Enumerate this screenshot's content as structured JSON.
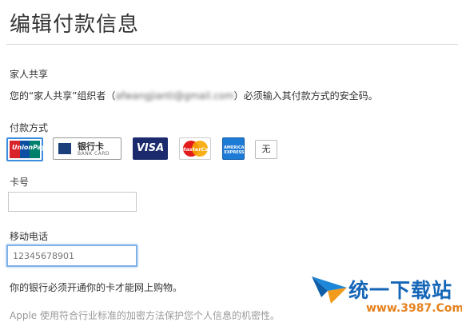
{
  "page": {
    "title": "编辑付款信息"
  },
  "family_sharing": {
    "heading": "家人共享",
    "message_prefix": "您的“家人共享”组织者（",
    "organizer_email": "afwangjianti@gmail.com",
    "message_suffix": "）必须输入其付款方式的安全码。"
  },
  "payment_method": {
    "heading": "付款方式",
    "options": [
      {
        "name": "UnionPay",
        "text": "UnionPay",
        "selected": true
      },
      {
        "name": "bank-card",
        "text": "银行卡",
        "subtext": "BANK CARD",
        "selected": false
      },
      {
        "name": "visa",
        "text": "VISA",
        "selected": false
      },
      {
        "name": "mastercard",
        "text": "MasterCard",
        "selected": false
      },
      {
        "name": "amex",
        "text": "AMERICAN EXPRESS",
        "selected": false
      },
      {
        "name": "none",
        "text": "无",
        "selected": false
      }
    ]
  },
  "card_number": {
    "label": "卡号",
    "value": "",
    "placeholder": ""
  },
  "mobile_phone": {
    "label": "移动电话",
    "value": "",
    "placeholder": "12345678901"
  },
  "notes": {
    "bank": "你的银行必须开通你的卡才能网上购物。",
    "security": "Apple 使用符合行业标准的加密方法保护您个人信息的机密性。"
  },
  "watermark": {
    "title": "统一下载站",
    "url": "www.3987.Com"
  },
  "colors": {
    "focus_border": "#7fb1e8",
    "visa_blue": "#1a2a6c",
    "watermark_blue": "#1666b7",
    "watermark_orange": "#e5821e"
  }
}
